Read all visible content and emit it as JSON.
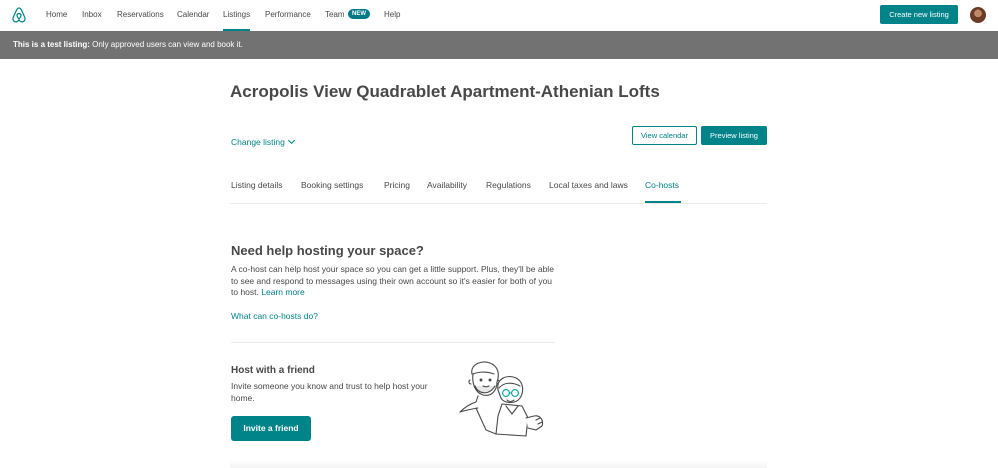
{
  "nav": {
    "items": [
      {
        "label": "Home"
      },
      {
        "label": "Inbox"
      },
      {
        "label": "Reservations"
      },
      {
        "label": "Calendar"
      },
      {
        "label": "Listings"
      },
      {
        "label": "Performance"
      },
      {
        "label": "Team"
      },
      {
        "label": "Help"
      }
    ],
    "active": "Listings",
    "team_badge": "NEW",
    "create_button": "Create new listing",
    "logo_icon": "airbnb-logo-icon",
    "avatar_icon": "user-avatar"
  },
  "banner": {
    "bold": "This is a test listing:",
    "text": " Only approved users can view and book it."
  },
  "listing": {
    "title": "Acropolis View Quadrablet Apartment-Athenian Lofts",
    "change_listing": "Change listing",
    "view_calendar": "View calendar",
    "preview_listing": "Preview listing"
  },
  "tabs": [
    {
      "label": "Listing details"
    },
    {
      "label": "Booking settings"
    },
    {
      "label": "Pricing"
    },
    {
      "label": "Availability"
    },
    {
      "label": "Regulations"
    },
    {
      "label": "Local taxes and laws"
    },
    {
      "label": "Co-hosts"
    }
  ],
  "active_tab": "Co-hosts",
  "cohosts": {
    "heading": "Need help hosting your space?",
    "description": "A co-host can help host your space so you can get a little support. Plus, they'll be able to see and respond to messages using their own account so it's easier for both of you to host.",
    "learn_more": "Learn more",
    "what_can": "What can co-hosts do?",
    "friend_heading": "Host with a friend",
    "friend_text": "Invite someone you know and trust to help host your home.",
    "invite_button": "Invite a friend"
  },
  "colors": {
    "accent": "#008489",
    "banner": "#727272",
    "text": "#484848"
  }
}
